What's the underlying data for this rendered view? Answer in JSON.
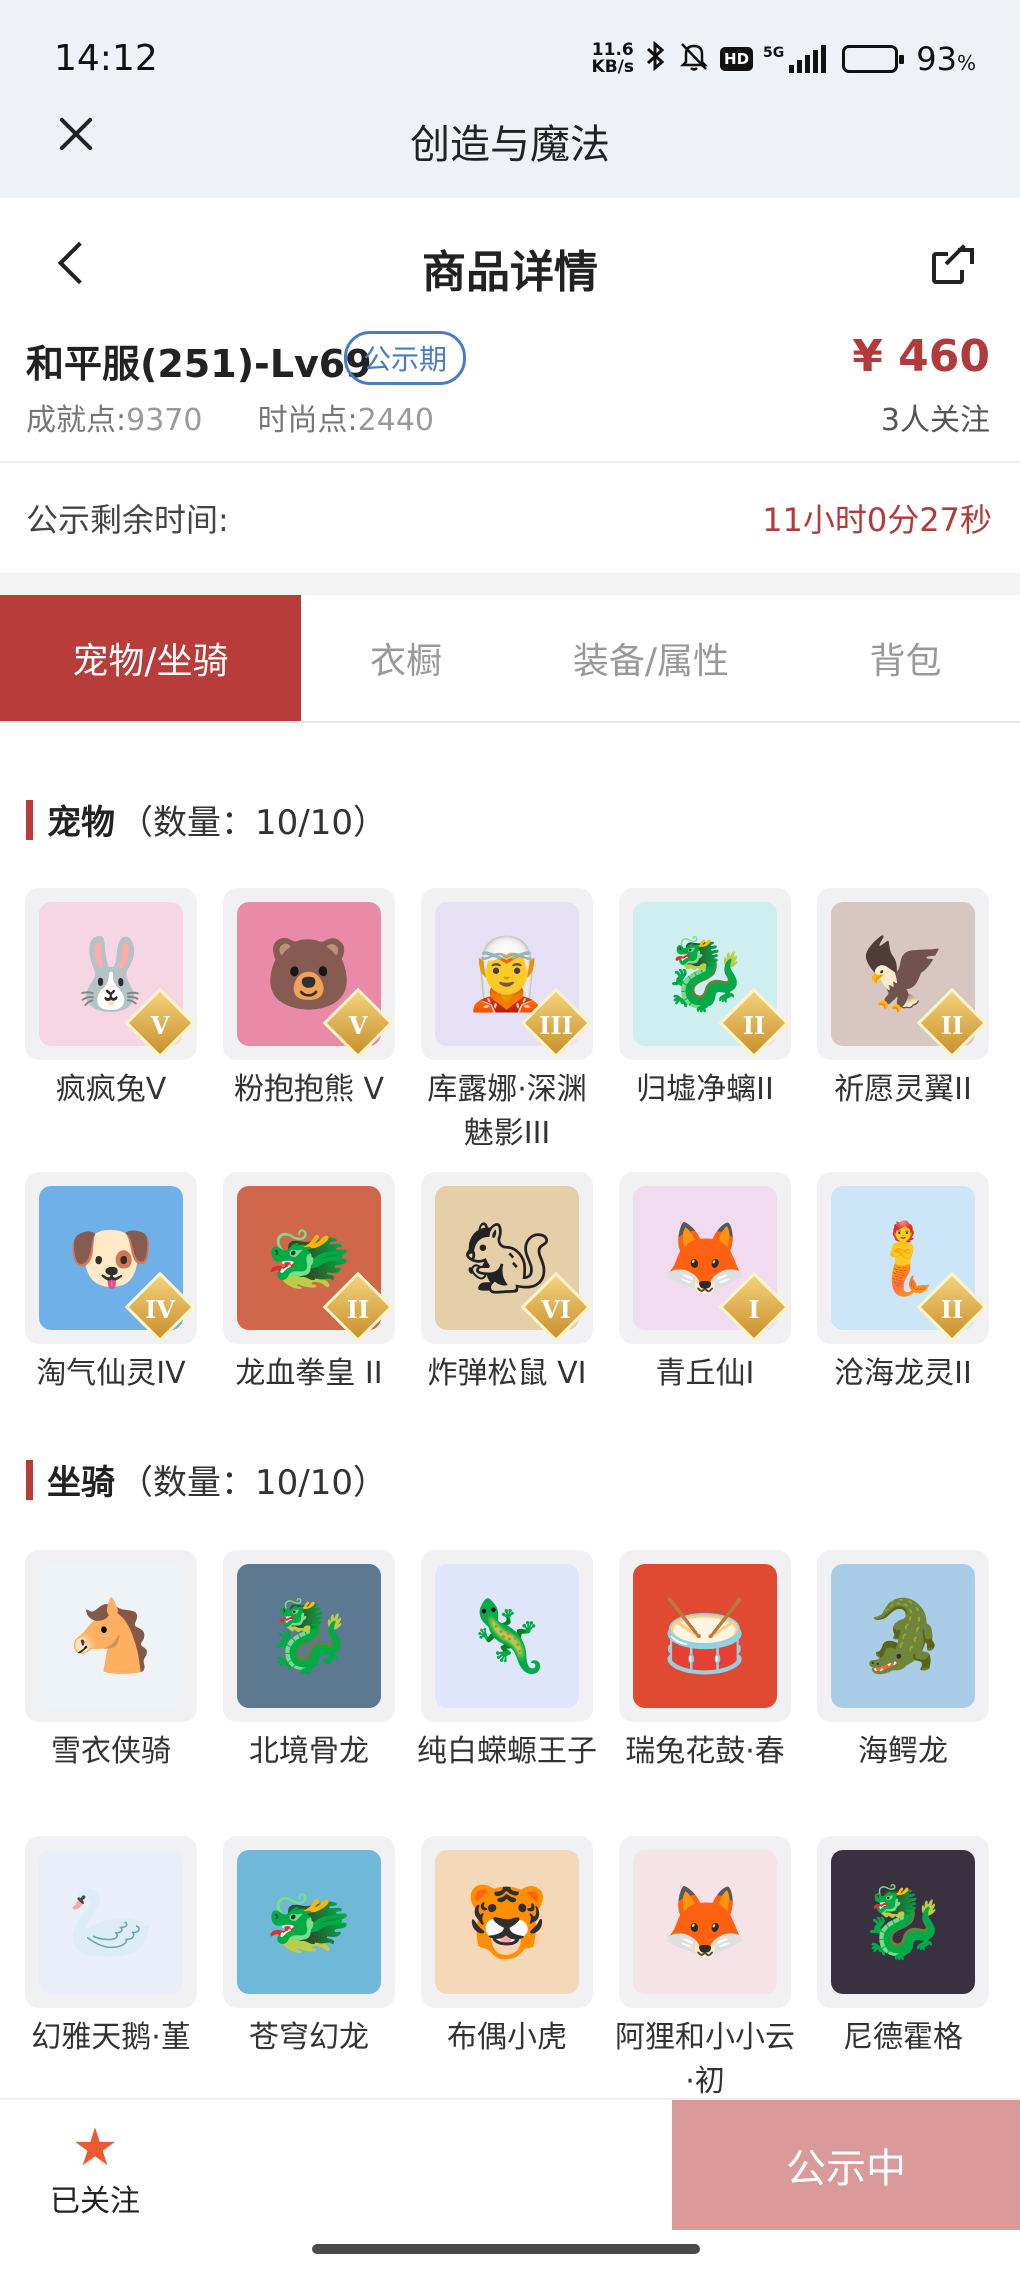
{
  "status_bar": {
    "time": "14:12",
    "net_speed_value": "11.6",
    "net_speed_unit": "KB/s",
    "battery_percent": "93",
    "battery_suffix": "%",
    "battery_level": 0.93,
    "icons": [
      "bluetooth-icon",
      "bell-muted-icon",
      "hd-icon",
      "signal-5g-icon",
      "battery-icon"
    ],
    "hd_label": "HD",
    "network": "5G"
  },
  "app_header": {
    "title": "创造与魔法"
  },
  "page_header": {
    "title": "商品详情"
  },
  "product": {
    "name": "和平服(251)-Lv69",
    "badge": "公示期",
    "price": "¥ 460",
    "achievement_label": "成就点:",
    "achievement_value": "9370",
    "fashion_label": "时尚点:",
    "fashion_value": "2440",
    "followers": "3人关注"
  },
  "countdown": {
    "label": "公示剩余时间:",
    "value": "11小时0分27秒"
  },
  "tabs": [
    {
      "label": "宠物/坐骑",
      "active": true
    },
    {
      "label": "衣橱",
      "active": false
    },
    {
      "label": "装备/属性",
      "active": false
    },
    {
      "label": "背包",
      "active": false
    }
  ],
  "pets": {
    "title": "宠物",
    "count": "（数量：10/10）",
    "items": [
      {
        "name": "疯疯兔V",
        "grade": "V",
        "icon": "rabbit",
        "glyph": "🐰",
        "color": "#f7d6e4"
      },
      {
        "name": "粉抱抱熊 V",
        "grade": "V",
        "icon": "bear",
        "glyph": "🐻",
        "color": "#e98aa8"
      },
      {
        "name": "库露娜·深渊魅影III",
        "grade": "III",
        "icon": "fairy",
        "glyph": "🧝",
        "color": "#e6e0f5"
      },
      {
        "name": "归墟净螭II",
        "grade": "II",
        "icon": "dragon",
        "glyph": "🐉",
        "color": "#cfeef0"
      },
      {
        "name": "祈愿灵翼II",
        "grade": "II",
        "icon": "eagle",
        "glyph": "🦅",
        "color": "#d8c6c0"
      },
      {
        "name": "淘气仙灵IV",
        "grade": "IV",
        "icon": "dog",
        "glyph": "🐶",
        "color": "#6fb0e8"
      },
      {
        "name": "龙血拳皇 II",
        "grade": "II",
        "icon": "beast",
        "glyph": "🐲",
        "color": "#d0664a"
      },
      {
        "name": "炸弹松鼠 VI",
        "grade": "VI",
        "icon": "squirrel",
        "glyph": "🐿",
        "color": "#e4cfa8"
      },
      {
        "name": "青丘仙I",
        "grade": "I",
        "icon": "fox-girl",
        "glyph": "🦊",
        "color": "#f1dcef"
      },
      {
        "name": "沧海龙灵II",
        "grade": "II",
        "icon": "dragon-girl",
        "glyph": "🧜",
        "color": "#cde6f7"
      }
    ]
  },
  "mounts": {
    "title": "坐骑",
    "count": "（数量：10/10）",
    "items": [
      {
        "name": "雪衣侠骑",
        "icon": "horse",
        "glyph": "🐴",
        "color": "#eef3f8"
      },
      {
        "name": "北境骨龙",
        "icon": "bone-dragon",
        "glyph": "🐉",
        "color": "#5d7891"
      },
      {
        "name": "纯白蝾螈王子",
        "icon": "salamander",
        "glyph": "🦎",
        "color": "#dfe5fb"
      },
      {
        "name": "瑞兔花鼓·春",
        "icon": "drum",
        "glyph": "🥁",
        "color": "#e04a32"
      },
      {
        "name": "海鳄龙",
        "icon": "sea-dragon",
        "glyph": "🐊",
        "color": "#a9cde6"
      },
      {
        "name": "幻雅天鹅·堇",
        "icon": "swan",
        "glyph": "🦢",
        "color": "#e9eef8"
      },
      {
        "name": "苍穹幻龙",
        "icon": "sky-dragon",
        "glyph": "🐲",
        "color": "#6fb8d8"
      },
      {
        "name": "布偶小虎",
        "icon": "tiger",
        "glyph": "🐯",
        "color": "#f3d9b8"
      },
      {
        "name": "阿狸和小小云·初",
        "icon": "ali-fox",
        "glyph": "🦊",
        "color": "#f6e3e8"
      },
      {
        "name": "尼德霍格",
        "icon": "dark-dragon",
        "glyph": "🐉",
        "color": "#3a3140"
      }
    ]
  },
  "bottom_bar": {
    "follow_label": "已关注",
    "action_label": "公示中"
  }
}
